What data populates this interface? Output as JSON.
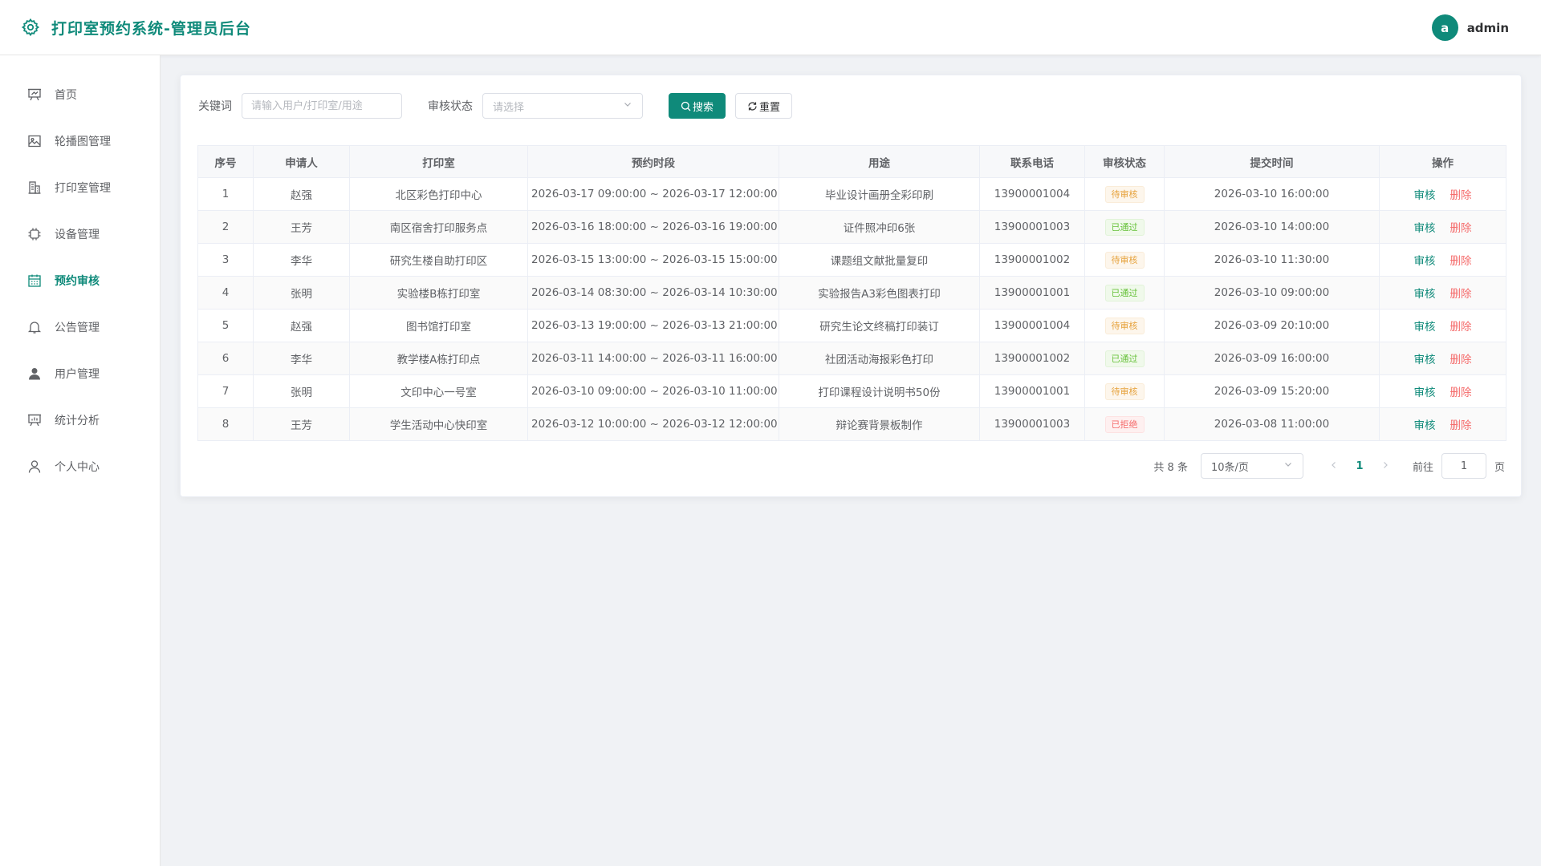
{
  "header": {
    "title": "打印室预约系统-管理员后台",
    "avatar_letter": "a",
    "username": "admin",
    "accent": "#0f8a7a"
  },
  "sidebar": {
    "items": [
      {
        "label": "首页",
        "icon": "presentation-icon"
      },
      {
        "label": "轮播图管理",
        "icon": "image-icon"
      },
      {
        "label": "打印室管理",
        "icon": "building-icon"
      },
      {
        "label": "设备管理",
        "icon": "cpu-icon"
      },
      {
        "label": "预约审核",
        "icon": "calendar-icon",
        "active": true
      },
      {
        "label": "公告管理",
        "icon": "bell-icon"
      },
      {
        "label": "用户管理",
        "icon": "user-filled-icon"
      },
      {
        "label": "统计分析",
        "icon": "chart-board-icon"
      },
      {
        "label": "个人中心",
        "icon": "user-icon"
      }
    ]
  },
  "filter": {
    "keyword_label": "关键词",
    "keyword_placeholder": "请输入用户/打印室/用途",
    "status_label": "审核状态",
    "status_placeholder": "请选择",
    "search_label": "搜索",
    "reset_label": "重置"
  },
  "table": {
    "columns": [
      "序号",
      "申请人",
      "打印室",
      "预约时段",
      "用途",
      "联系电话",
      "审核状态",
      "提交时间",
      "操作"
    ],
    "audit_label": "审核",
    "delete_label": "删除",
    "rows": [
      {
        "no": "1",
        "applicant": "赵强",
        "room": "北区彩色打印中心",
        "period": "2026-03-17 09:00:00 ~ 2026-03-17 12:00:00",
        "purpose": "毕业设计画册全彩印刷",
        "phone": "13900001004",
        "status": "待审核",
        "status_type": "pending",
        "submitted": "2026-03-10 16:00:00"
      },
      {
        "no": "2",
        "applicant": "王芳",
        "room": "南区宿舍打印服务点",
        "period": "2026-03-16 18:00:00 ~ 2026-03-16 19:00:00",
        "purpose": "证件照冲印6张",
        "phone": "13900001003",
        "status": "已通过",
        "status_type": "pass",
        "submitted": "2026-03-10 14:00:00"
      },
      {
        "no": "3",
        "applicant": "李华",
        "room": "研究生楼自助打印区",
        "period": "2026-03-15 13:00:00 ~ 2026-03-15 15:00:00",
        "purpose": "课题组文献批量复印",
        "phone": "13900001002",
        "status": "待审核",
        "status_type": "pending",
        "submitted": "2026-03-10 11:30:00"
      },
      {
        "no": "4",
        "applicant": "张明",
        "room": "实验楼B栋打印室",
        "period": "2026-03-14 08:30:00 ~ 2026-03-14 10:30:00",
        "purpose": "实验报告A3彩色图表打印",
        "phone": "13900001001",
        "status": "已通过",
        "status_type": "pass",
        "submitted": "2026-03-10 09:00:00"
      },
      {
        "no": "5",
        "applicant": "赵强",
        "room": "图书馆打印室",
        "period": "2026-03-13 19:00:00 ~ 2026-03-13 21:00:00",
        "purpose": "研究生论文终稿打印装订",
        "phone": "13900001004",
        "status": "待审核",
        "status_type": "pending",
        "submitted": "2026-03-09 20:10:00"
      },
      {
        "no": "6",
        "applicant": "李华",
        "room": "教学楼A栋打印点",
        "period": "2026-03-11 14:00:00 ~ 2026-03-11 16:00:00",
        "purpose": "社团活动海报彩色打印",
        "phone": "13900001002",
        "status": "已通过",
        "status_type": "pass",
        "submitted": "2026-03-09 16:00:00"
      },
      {
        "no": "7",
        "applicant": "张明",
        "room": "文印中心一号室",
        "period": "2026-03-10 09:00:00 ~ 2026-03-10 11:00:00",
        "purpose": "打印课程设计说明书50份",
        "phone": "13900001001",
        "status": "待审核",
        "status_type": "pending",
        "submitted": "2026-03-09 15:20:00"
      },
      {
        "no": "8",
        "applicant": "王芳",
        "room": "学生活动中心快印室",
        "period": "2026-03-12 10:00:00 ~ 2026-03-12 12:00:00",
        "purpose": "辩论赛背景板制作",
        "phone": "13900001003",
        "status": "已拒绝",
        "status_type": "reject",
        "submitted": "2026-03-08 11:00:00"
      }
    ]
  },
  "pagination": {
    "total_text": "共 8 条",
    "page_size": "10条/页",
    "current_page": "1",
    "goto_label": "前往",
    "goto_value": "1",
    "page_suffix": "页"
  }
}
